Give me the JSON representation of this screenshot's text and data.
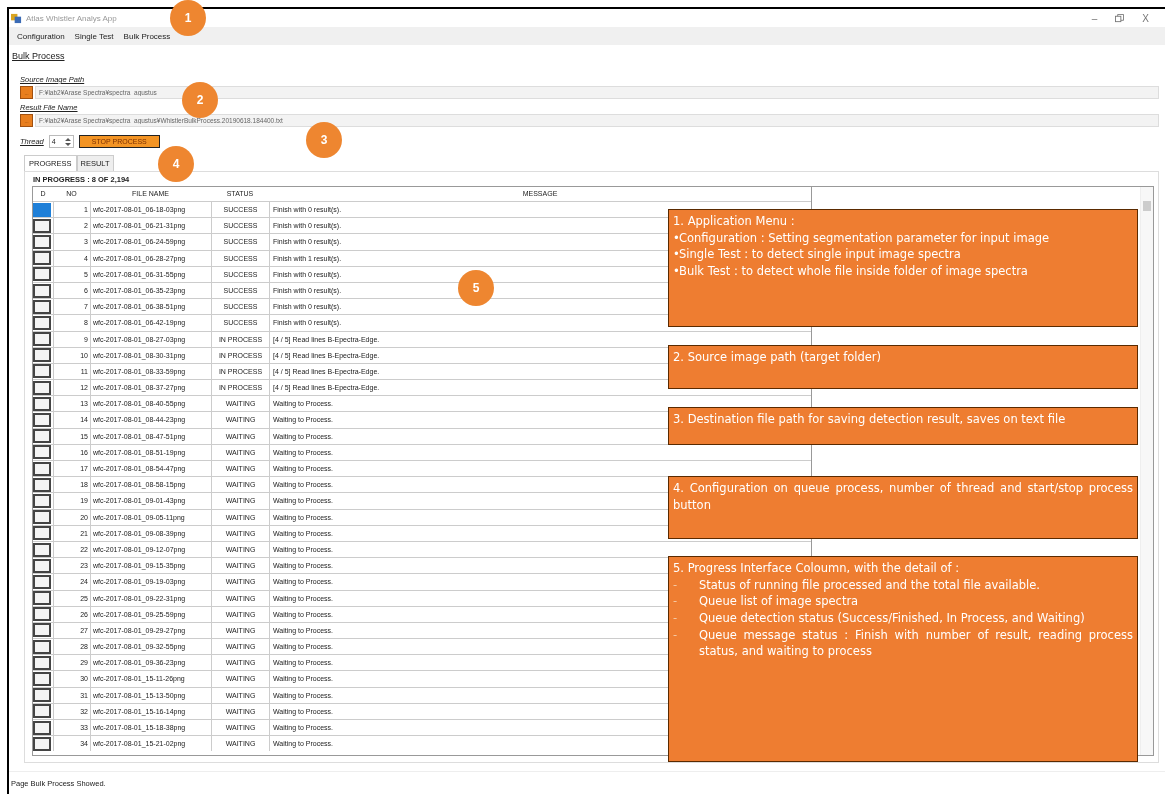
{
  "window": {
    "title": "Atlas Whistler Analys App",
    "controls": [
      "–",
      "X"
    ]
  },
  "menu": [
    {
      "label": "Configuration"
    },
    {
      "label": "Single Test"
    },
    {
      "label": "Bulk Process"
    }
  ],
  "page_title": "Bulk Process",
  "source": {
    "label": "Source Image Path",
    "button": "...",
    "value": "F:¥lab2¥Arase Spectra¥spectra_agustus"
  },
  "result_file": {
    "label": "Result File Name",
    "button": "...",
    "value": "F:¥lab2¥Arase Spectra¥spectra_agustus¥WhistlerBulkProcess.20190618.184400.txt"
  },
  "thread": {
    "label": "Thread",
    "value": "4"
  },
  "stop_button": "STOP PROCESS",
  "tabs": [
    {
      "label": "PROGRESS",
      "selected": true
    },
    {
      "label": "RESULT",
      "selected": false
    }
  ],
  "progress_label": "IN PROGRESS : 8 OF 2,194",
  "table": {
    "columns": [
      "D",
      "NO",
      "FILE NAME",
      "STATUS",
      "MESSAGE"
    ],
    "rows": [
      {
        "selected": true,
        "no": "1",
        "file": "wfc-2017-08-01_06-18-03png",
        "status": "SUCCESS",
        "message": "Finish with 0 result(s)."
      },
      {
        "selected": false,
        "no": "2",
        "file": "wfc-2017-08-01_06-21-31png",
        "status": "SUCCESS",
        "message": "Finish with 0 result(s)."
      },
      {
        "selected": false,
        "no": "3",
        "file": "wfc-2017-08-01_06-24-59png",
        "status": "SUCCESS",
        "message": "Finish with 0 result(s)."
      },
      {
        "selected": false,
        "no": "4",
        "file": "wfc-2017-08-01_06-28-27png",
        "status": "SUCCESS",
        "message": "Finish with 1 result(s)."
      },
      {
        "selected": false,
        "no": "5",
        "file": "wfc-2017-08-01_06-31-55png",
        "status": "SUCCESS",
        "message": "Finish with 0 result(s)."
      },
      {
        "selected": false,
        "no": "6",
        "file": "wfc-2017-08-01_06-35-23png",
        "status": "SUCCESS",
        "message": "Finish with 0 result(s)."
      },
      {
        "selected": false,
        "no": "7",
        "file": "wfc-2017-08-01_06-38-51png",
        "status": "SUCCESS",
        "message": "Finish with 0 result(s)."
      },
      {
        "selected": false,
        "no": "8",
        "file": "wfc-2017-08-01_06-42-19png",
        "status": "SUCCESS",
        "message": "Finish with 0 result(s)."
      },
      {
        "selected": false,
        "no": "9",
        "file": "wfc-2017-08-01_08-27-03png",
        "status": "IN PROCESS",
        "message": "[4 / 5] Read lines B-Epectra-Edge."
      },
      {
        "selected": false,
        "no": "10",
        "file": "wfc-2017-08-01_08-30-31png",
        "status": "IN PROCESS",
        "message": "[4 / 5] Read lines B-Epectra-Edge."
      },
      {
        "selected": false,
        "no": "11",
        "file": "wfc-2017-08-01_08-33-59png",
        "status": "IN PROCESS",
        "message": "[4 / 5] Read lines B-Epectra-Edge."
      },
      {
        "selected": false,
        "no": "12",
        "file": "wfc-2017-08-01_08-37-27png",
        "status": "IN PROCESS",
        "message": "[4 / 5] Read lines B-Epectra-Edge."
      },
      {
        "selected": false,
        "no": "13",
        "file": "wfc-2017-08-01_08-40-55png",
        "status": "WAITING",
        "message": "Waiting to Process."
      },
      {
        "selected": false,
        "no": "14",
        "file": "wfc-2017-08-01_08-44-23png",
        "status": "WAITING",
        "message": "Waiting to Process."
      },
      {
        "selected": false,
        "no": "15",
        "file": "wfc-2017-08-01_08-47-51png",
        "status": "WAITING",
        "message": "Waiting to Process."
      },
      {
        "selected": false,
        "no": "16",
        "file": "wfc-2017-08-01_08-51-19png",
        "status": "WAITING",
        "message": "Waiting to Process."
      },
      {
        "selected": false,
        "no": "17",
        "file": "wfc-2017-08-01_08-54-47png",
        "status": "WAITING",
        "message": "Waiting to Process."
      },
      {
        "selected": false,
        "no": "18",
        "file": "wfc-2017-08-01_08-58-15png",
        "status": "WAITING",
        "message": "Waiting to Process."
      },
      {
        "selected": false,
        "no": "19",
        "file": "wfc-2017-08-01_09-01-43png",
        "status": "WAITING",
        "message": "Waiting to Process."
      },
      {
        "selected": false,
        "no": "20",
        "file": "wfc-2017-08-01_09-05-11png",
        "status": "WAITING",
        "message": "Waiting to Process."
      },
      {
        "selected": false,
        "no": "21",
        "file": "wfc-2017-08-01_09-08-39png",
        "status": "WAITING",
        "message": "Waiting to Process."
      },
      {
        "selected": false,
        "no": "22",
        "file": "wfc-2017-08-01_09-12-07png",
        "status": "WAITING",
        "message": "Waiting to Process."
      },
      {
        "selected": false,
        "no": "23",
        "file": "wfc-2017-08-01_09-15-35png",
        "status": "WAITING",
        "message": "Waiting to Process."
      },
      {
        "selected": false,
        "no": "24",
        "file": "wfc-2017-08-01_09-19-03png",
        "status": "WAITING",
        "message": "Waiting to Process."
      },
      {
        "selected": false,
        "no": "25",
        "file": "wfc-2017-08-01_09-22-31png",
        "status": "WAITING",
        "message": "Waiting to Process."
      },
      {
        "selected": false,
        "no": "26",
        "file": "wfc-2017-08-01_09-25-59png",
        "status": "WAITING",
        "message": "Waiting to Process."
      },
      {
        "selected": false,
        "no": "27",
        "file": "wfc-2017-08-01_09-29-27png",
        "status": "WAITING",
        "message": "Waiting to Process."
      },
      {
        "selected": false,
        "no": "28",
        "file": "wfc-2017-08-01_09-32-55png",
        "status": "WAITING",
        "message": "Waiting to Process."
      },
      {
        "selected": false,
        "no": "29",
        "file": "wfc-2017-08-01_09-36-23png",
        "status": "WAITING",
        "message": "Waiting to Process."
      },
      {
        "selected": false,
        "no": "30",
        "file": "wfc-2017-08-01_15-11-26png",
        "status": "WAITING",
        "message": "Waiting to Process."
      },
      {
        "selected": false,
        "no": "31",
        "file": "wfc-2017-08-01_15-13-50png",
        "status": "WAITING",
        "message": "Waiting to Process."
      },
      {
        "selected": false,
        "no": "32",
        "file": "wfc-2017-08-01_15-16-14png",
        "status": "WAITING",
        "message": "Waiting to Process."
      },
      {
        "selected": false,
        "no": "33",
        "file": "wfc-2017-08-01_15-18-38png",
        "status": "WAITING",
        "message": "Waiting to Process."
      },
      {
        "selected": false,
        "no": "34",
        "file": "wfc-2017-08-01_15-21-02png",
        "status": "WAITING",
        "message": "Waiting to Process."
      }
    ]
  },
  "status_bar": "Page Bulk Process Showed.",
  "markers": [
    {
      "label": "1"
    },
    {
      "label": "2"
    },
    {
      "label": "3"
    },
    {
      "label": "4"
    },
    {
      "label": "5"
    }
  ],
  "notes": [
    {
      "title": "1. Application Menu :",
      "bullet": "•",
      "items": [
        "Configuration : Setting segmentation parameter for input image",
        "Single Test : to detect single input image spectra",
        "Bulk Test : to detect whole file inside folder of image spectra"
      ]
    },
    {
      "title": "2. Source image path (target folder)"
    },
    {
      "title": "3. Destination file path for saving detection result, saves on text file"
    },
    {
      "title": "4. Configuration on queue process, number of thread and start/stop process button"
    },
    {
      "title": "5. Progress Interface Coloumn, with the detail of :",
      "bullet": "-",
      "items": [
        "Status of running file processed and the total  file available.",
        "Queue list of image spectra",
        "Queue detection status (Success/Finished, In Process, and Waiting)",
        "Queue message status : Finish with number of result, reading process status, and waiting to process"
      ]
    }
  ]
}
